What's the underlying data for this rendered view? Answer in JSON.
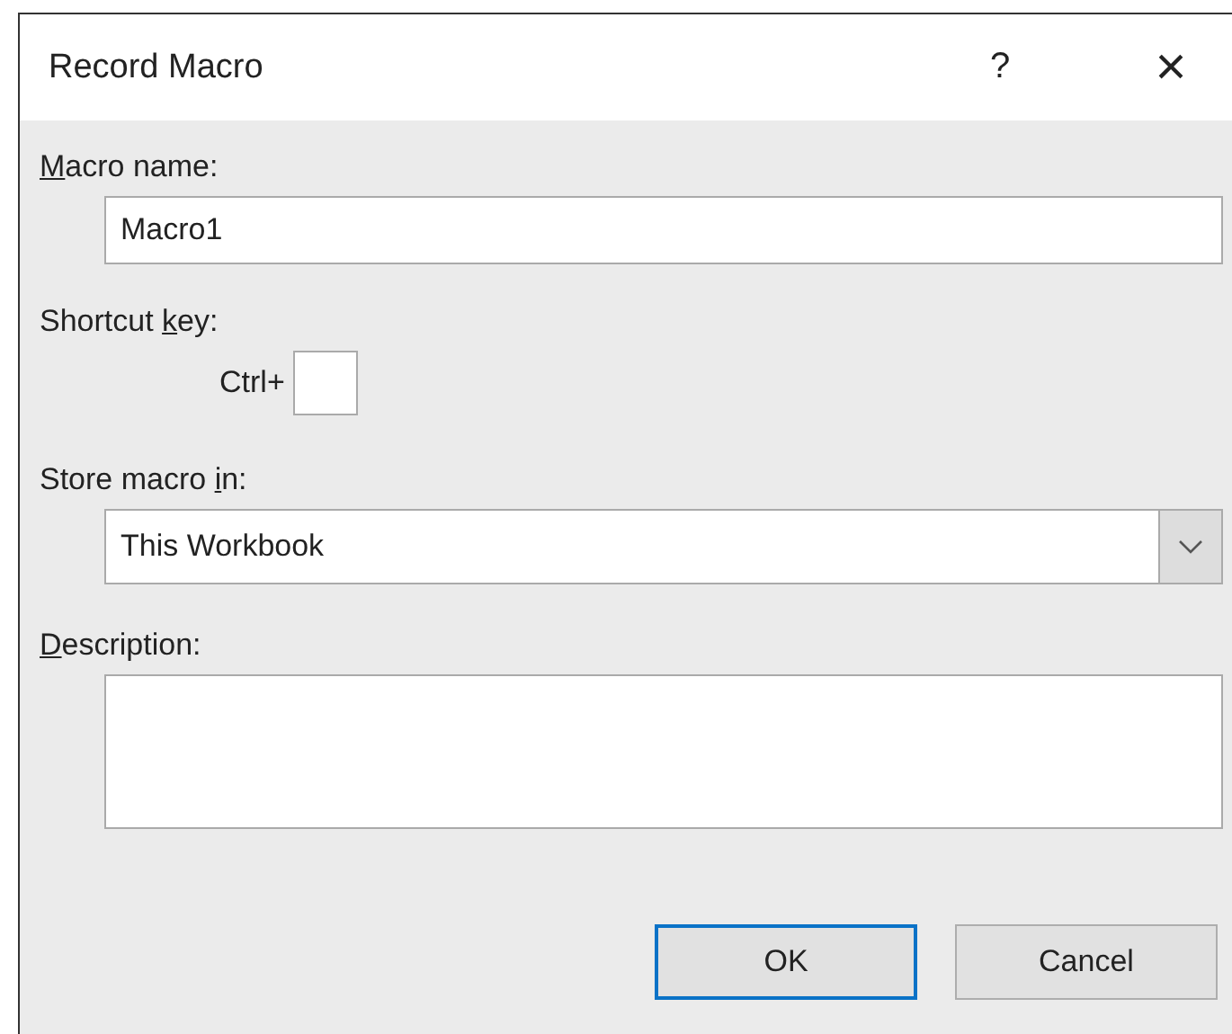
{
  "window": {
    "title": "Record Macro",
    "help": "?",
    "close": "×"
  },
  "macro_name": {
    "mnemonic": "M",
    "label_rest": "acro name:",
    "value": "Macro1"
  },
  "shortcut_key": {
    "label_start": "Shortcut ",
    "mnemonic": "k",
    "label_rest": "ey:",
    "prefix": "Ctrl+"
  },
  "store_macro_in": {
    "label_start": "Store macro ",
    "mnemonic": "i",
    "label_rest": "n:",
    "value": "This Workbook"
  },
  "description": {
    "mnemonic": "D",
    "label_rest": "escription:"
  },
  "buttons": [
    {
      "label": "OK",
      "default": true
    },
    {
      "label": "Cancel",
      "default": false
    }
  ]
}
